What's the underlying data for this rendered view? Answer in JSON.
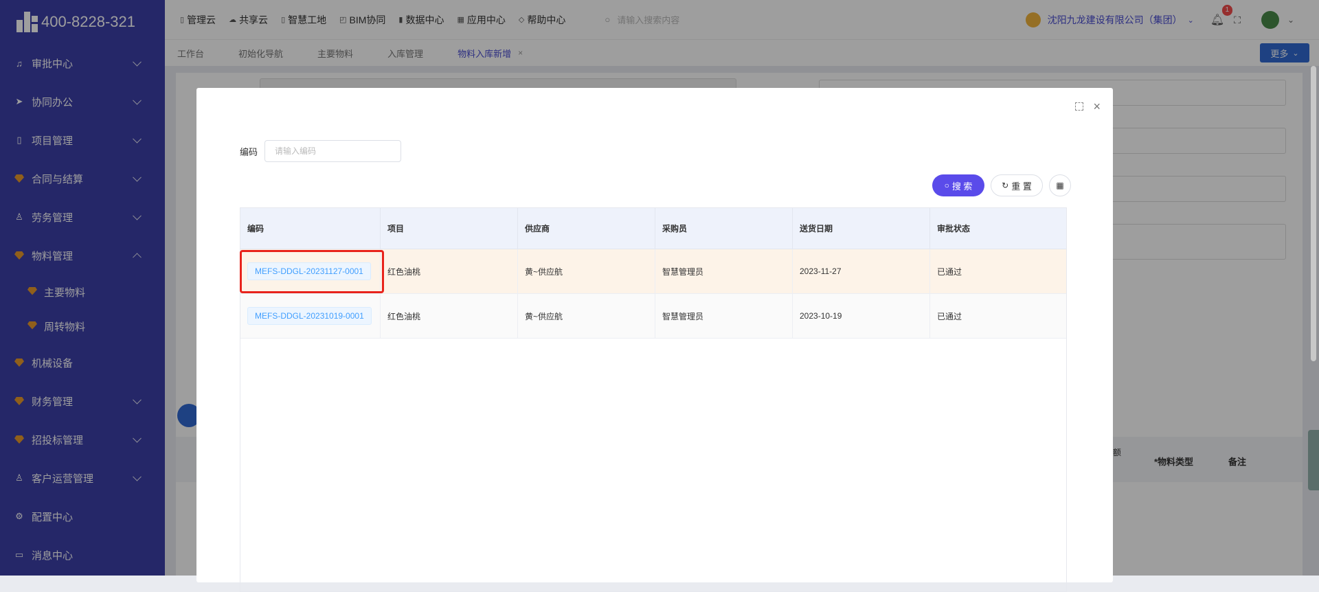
{
  "brand": {
    "phone": "400-8228-321"
  },
  "sidebar": {
    "items": [
      {
        "label": "审批中心",
        "icon": "bell-icon",
        "expandable": true
      },
      {
        "label": "协同办公",
        "icon": "send-icon",
        "expandable": true
      },
      {
        "label": "项目管理",
        "icon": "book-icon",
        "expandable": true
      },
      {
        "label": "合同与结算",
        "icon": "gem-icon",
        "expandable": true
      },
      {
        "label": "劳务管理",
        "icon": "user-icon",
        "expandable": true
      },
      {
        "label": "物料管理",
        "icon": "gem-icon",
        "expandable": true,
        "expanded": true
      },
      {
        "label": "主要物料",
        "icon": "gem-icon",
        "sub": true
      },
      {
        "label": "周转物料",
        "icon": "gem-icon",
        "sub": true
      },
      {
        "label": "机械设备",
        "icon": "gem-icon",
        "expandable": false
      },
      {
        "label": "财务管理",
        "icon": "gem-icon",
        "expandable": true
      },
      {
        "label": "招投标管理",
        "icon": "gem-icon",
        "expandable": true
      },
      {
        "label": "客户运营管理",
        "icon": "user-icon",
        "expandable": true
      },
      {
        "label": "配置中心",
        "icon": "gear-icon",
        "expandable": false
      },
      {
        "label": "消息中心",
        "icon": "message-icon",
        "expandable": false
      }
    ]
  },
  "topnav": {
    "items": [
      "管理云",
      "共享云",
      "智慧工地",
      "BIM协同",
      "数据中心",
      "应用中心",
      "帮助中心"
    ],
    "search_placeholder": "请输入搜索内容",
    "org_name": "沈阳九龙建设有限公司（集团）",
    "notification_count": "1"
  },
  "tabs": {
    "items": [
      "工作台",
      "初始化导航",
      "主要物料",
      "入库管理",
      "物料入库新增"
    ],
    "active": "物料入库新增",
    "more_label": "更多"
  },
  "background": {
    "table_headers": [
      "*物料类型",
      "备注"
    ],
    "partial_header": "额"
  },
  "modal": {
    "filter_label": "编码",
    "filter_placeholder": "请输入编码",
    "search_label": "搜 索",
    "reset_label": "重 置",
    "columns": [
      "编码",
      "项目",
      "供应商",
      "采购员",
      "送货日期",
      "审批状态"
    ],
    "rows": [
      [
        "MEFS-DDGL-20231127-0001",
        "红色油桃",
        "黄~供应航",
        "智慧管理员",
        "2023-11-27",
        "已通过"
      ],
      [
        "MEFS-DDGL-20231019-0001",
        "红色油桃",
        "黄~供应航",
        "智慧管理员",
        "2023-10-19",
        "已通过"
      ]
    ]
  },
  "colors": {
    "sidebar": "#3d3fa8",
    "accent": "#5a4bea",
    "link": "#409eff",
    "highlight_row": "#fdf3e8",
    "annotation": "#e8231c"
  }
}
